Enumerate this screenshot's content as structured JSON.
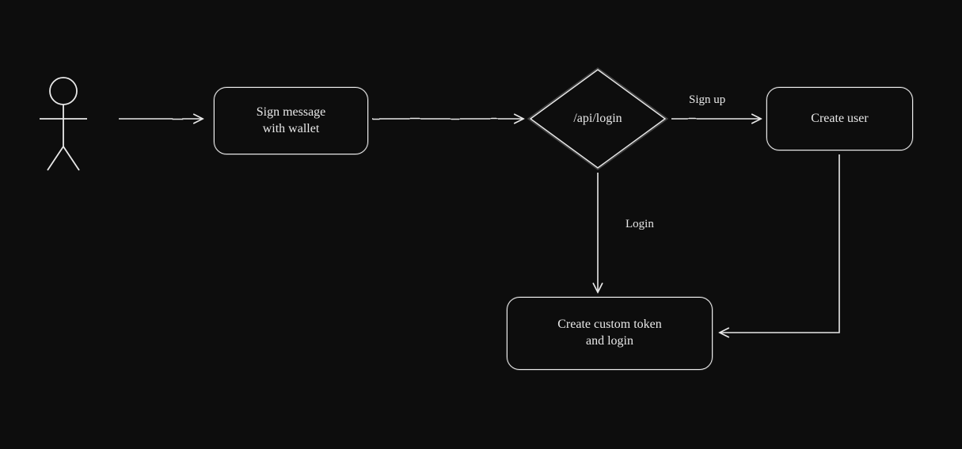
{
  "nodes": {
    "actor": {
      "name": "user-actor"
    },
    "sign": {
      "label": "Sign message\nwith wallet"
    },
    "api": {
      "label": "/api/login"
    },
    "create_user": {
      "label": "Create user"
    },
    "token": {
      "label": "Create custom token\nand login"
    }
  },
  "edges": {
    "signup": {
      "label": "Sign up"
    },
    "login": {
      "label": "Login"
    }
  },
  "chart_data": {
    "type": "flowchart",
    "nodes": [
      {
        "id": "actor",
        "kind": "actor",
        "label": ""
      },
      {
        "id": "sign",
        "kind": "process",
        "label": "Sign message with wallet"
      },
      {
        "id": "api",
        "kind": "decision",
        "label": "/api/login"
      },
      {
        "id": "create_user",
        "kind": "process",
        "label": "Create user"
      },
      {
        "id": "token",
        "kind": "process",
        "label": "Create custom token and login"
      }
    ],
    "edges": [
      {
        "from": "actor",
        "to": "sign",
        "label": ""
      },
      {
        "from": "sign",
        "to": "api",
        "label": ""
      },
      {
        "from": "api",
        "to": "create_user",
        "label": "Sign up"
      },
      {
        "from": "api",
        "to": "token",
        "label": "Login"
      },
      {
        "from": "create_user",
        "to": "token",
        "label": ""
      }
    ]
  }
}
